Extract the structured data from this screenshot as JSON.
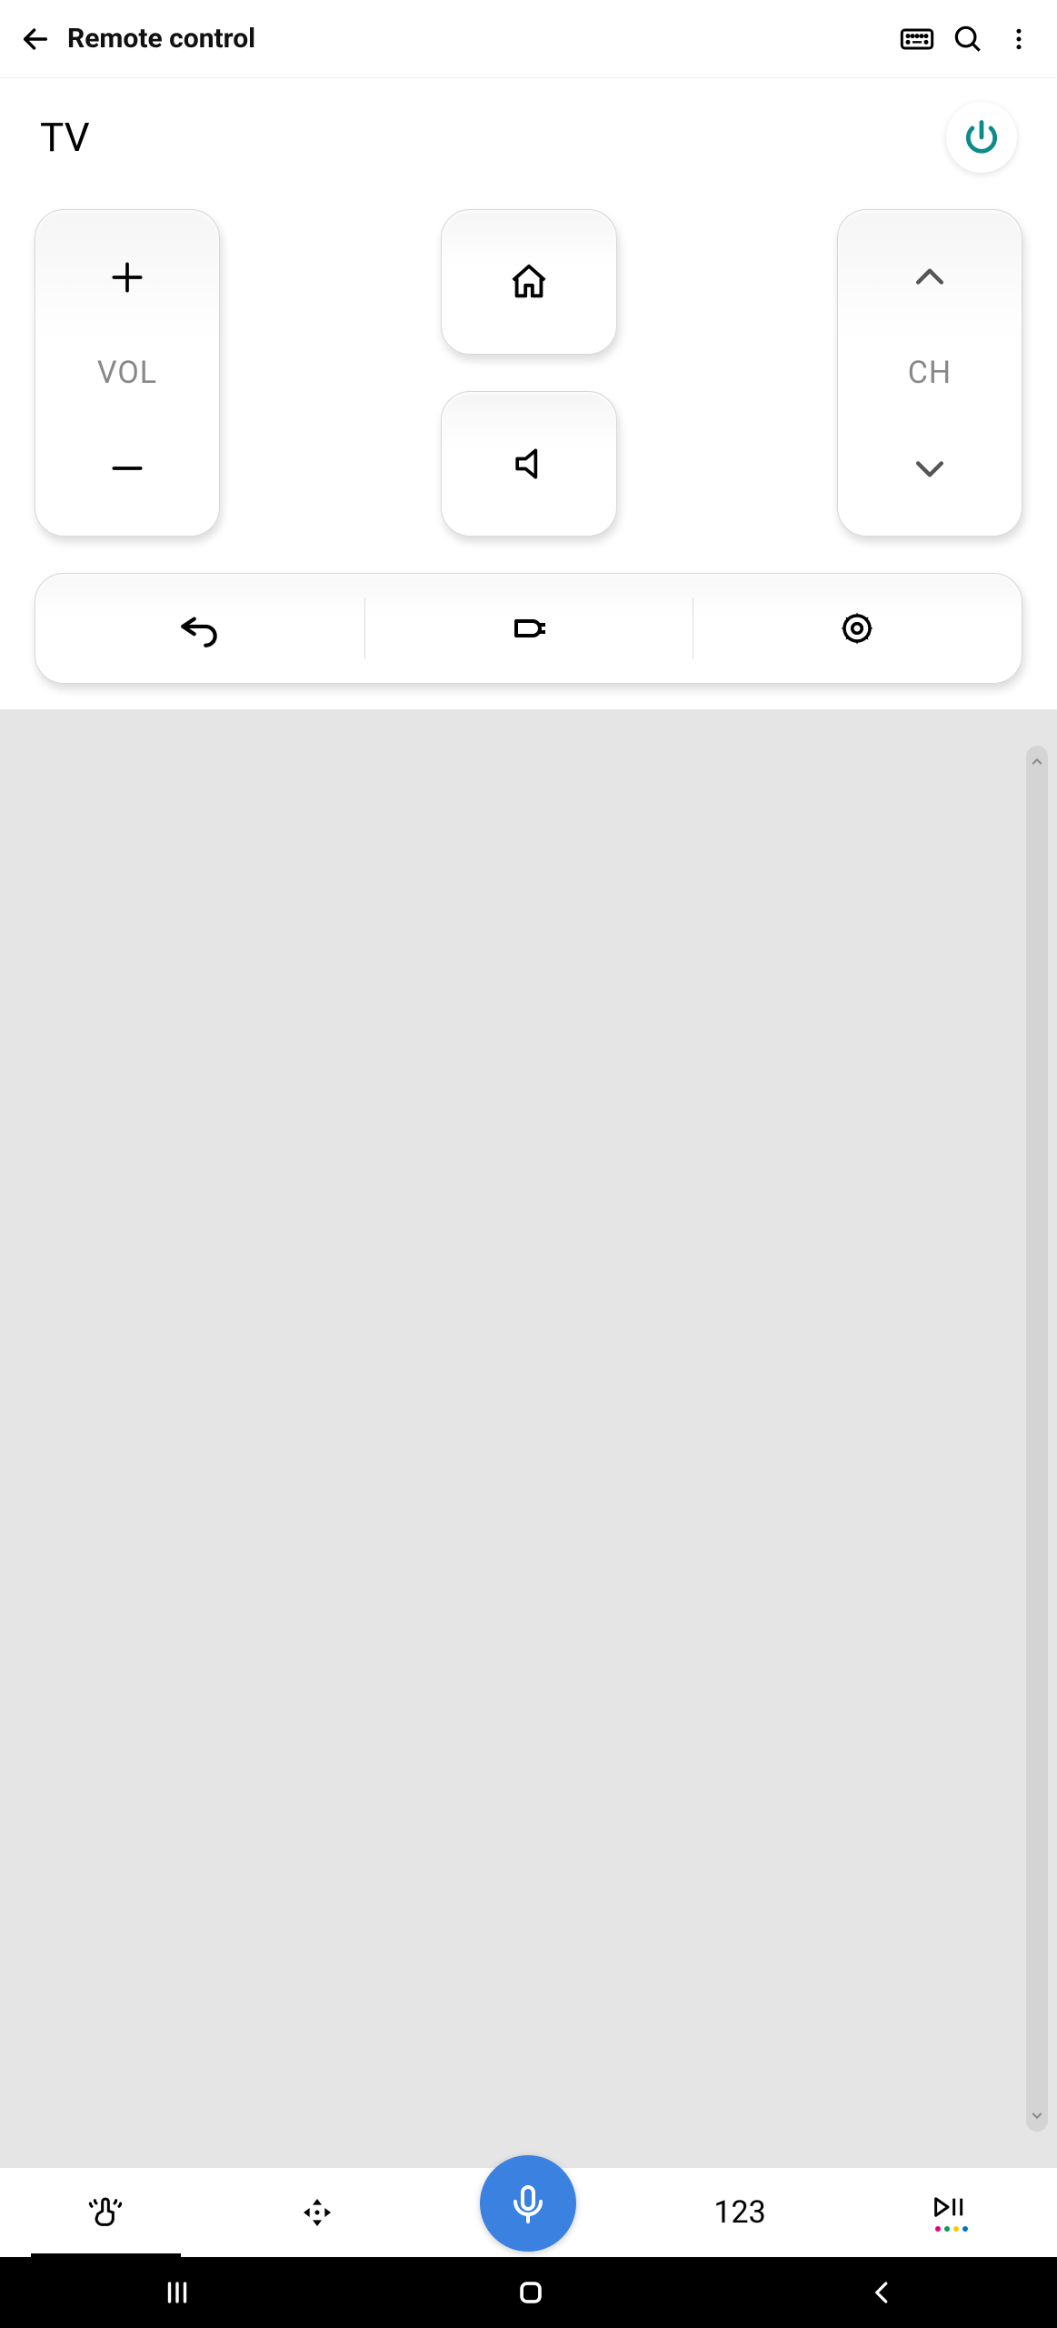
{
  "header": {
    "title": "Remote control"
  },
  "device": {
    "name": "TV"
  },
  "controls": {
    "volume_label": "VOL",
    "channel_label": "CH"
  },
  "bottom": {
    "numeric_label": "123"
  },
  "colors": {
    "power_icon": "#0d8a8a",
    "mic_bg": "#3b82e0",
    "dot_colors": [
      "#e6007e",
      "#00a651",
      "#ffcc00",
      "#0072ce"
    ]
  }
}
